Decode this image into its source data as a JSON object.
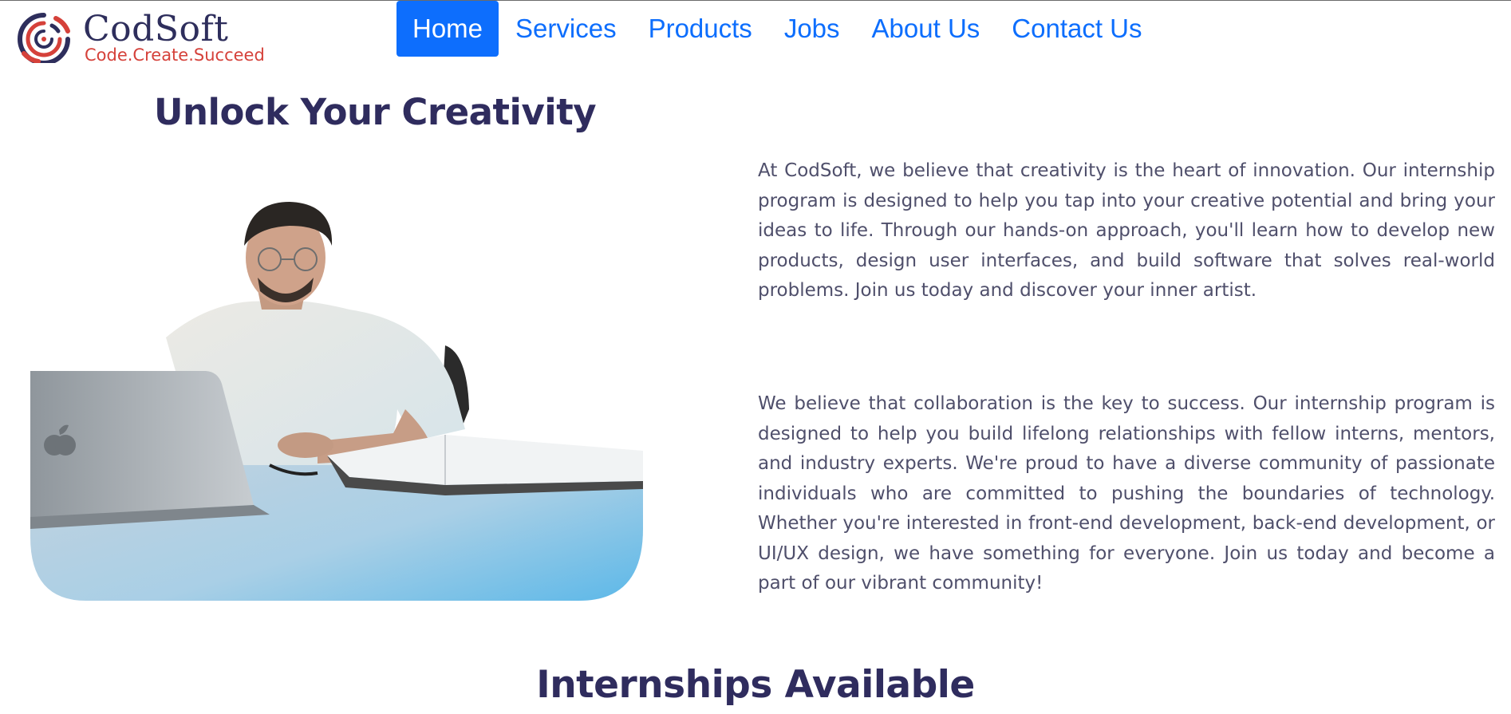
{
  "brand": {
    "name": "CodSoft",
    "tagline": "Code.Create.Succeed",
    "colors": {
      "navy": "#2e2e5c",
      "red": "#d5413a"
    }
  },
  "nav": {
    "accent": "#0d6efd",
    "items": [
      {
        "label": "Home",
        "active": true
      },
      {
        "label": "Services",
        "active": false
      },
      {
        "label": "Products",
        "active": false
      },
      {
        "label": "Jobs",
        "active": false
      },
      {
        "label": "About Us",
        "active": false
      },
      {
        "label": "Contact Us",
        "active": false
      }
    ]
  },
  "hero": {
    "title": "Unlock Your Creativity",
    "image_icon": "person-at-laptop-photo",
    "paragraphs": [
      "At CodSoft, we believe that creativity is the heart of innovation. Our internship program is designed to help you tap into your creative potential and bring your ideas to life. Through our hands-on approach, you'll learn how to develop new products, design user interfaces, and build software that solves real-world problems. Join us today and discover your inner artist.",
      "We believe that collaboration is the key to success. Our internship program is designed to help you build lifelong relationships with fellow interns, mentors, and industry experts. We're proud to have a diverse community of passionate individuals who are committed to pushing the boundaries of technology. Whether you're interested in front-end development, back-end development, or UI/UX design, we have something for everyone. Join us today and become a part of our vibrant community!"
    ]
  },
  "internships": {
    "title": "Internships Available"
  }
}
